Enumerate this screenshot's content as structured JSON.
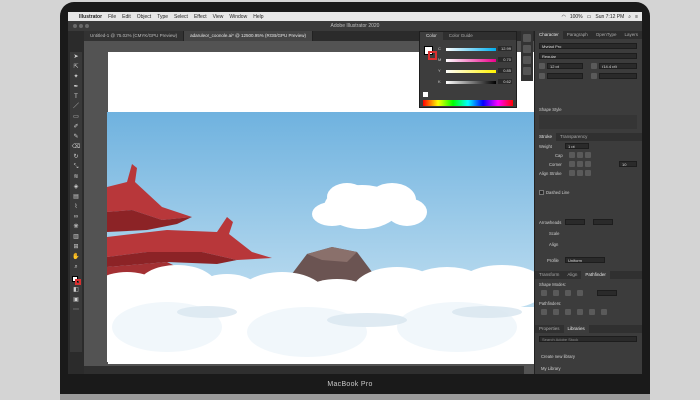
{
  "device": {
    "label": "MacBook Pro"
  },
  "menubar": {
    "app": "Illustrator",
    "items": [
      "File",
      "Edit",
      "Object",
      "Type",
      "Select",
      "Effect",
      "View",
      "Window",
      "Help"
    ],
    "battery": "100%",
    "clock": "Sun 7:12 PM"
  },
  "window": {
    "title": "Adobe Illustrator 2020"
  },
  "doc_tabs": [
    {
      "label": "Untitled-1 @ 75.02% (CMYK/GPU Preview)"
    },
    {
      "label": "adaruleor_coonole.ai* @ 12500.95% (RGB/GPU Preview)"
    }
  ],
  "color_panel": {
    "tabs": [
      "Color",
      "Color Guide"
    ],
    "sliders": [
      {
        "label": "C",
        "value": "12.99",
        "gradient": "linear-gradient(to right,#fff,#00aeef)"
      },
      {
        "label": "M",
        "value": "0.70",
        "gradient": "linear-gradient(to right,#fff,#ec008c)"
      },
      {
        "label": "Y",
        "value": "0.85",
        "gradient": "linear-gradient(to right,#fff,#fff200)"
      },
      {
        "label": "K",
        "value": "0.62",
        "gradient": "linear-gradient(to right,#fff,#000)"
      }
    ]
  },
  "right_panel": {
    "tabs": [
      "Character",
      "Paragraph",
      "OpenType",
      "Layers"
    ],
    "font_family": "Myriad Pro",
    "font_style": "Regular",
    "font_size": "12 pt",
    "leading": "(14.4 pt)",
    "shape_label": "Shape Style",
    "stroke_tabs": [
      "Stroke",
      "Transparency"
    ],
    "weight_label": "Weight",
    "weight_value": "1 pt",
    "cap_label": "Cap",
    "corner_label": "Corner",
    "limit_value": "10",
    "align_label": "Align Stroke",
    "dashed_label": "Dashed Line",
    "arrowheads_label": "Arrowheads",
    "scale_label": "Scale",
    "align_label2": "Align",
    "profile_label": "Profile",
    "profile_value": "Uniform",
    "tools_tabs": [
      "Transform",
      "Align",
      "Pathfinder"
    ],
    "shape_modes": "Shape Modes:",
    "pathfinders": "Pathfinders:",
    "bottom_tabs": [
      "Properties",
      "Libraries"
    ],
    "search_placeholder": "Search Adobe Stock",
    "create_library": "Create new library",
    "my_library": "My Library"
  },
  "colors": {
    "sky_top": "#6fb2df",
    "sky_bottom": "#cfe6f3",
    "roof": "#b8373a",
    "mountain": "#6b5452",
    "cloud": "#ffffff",
    "accent": "#d93030"
  }
}
